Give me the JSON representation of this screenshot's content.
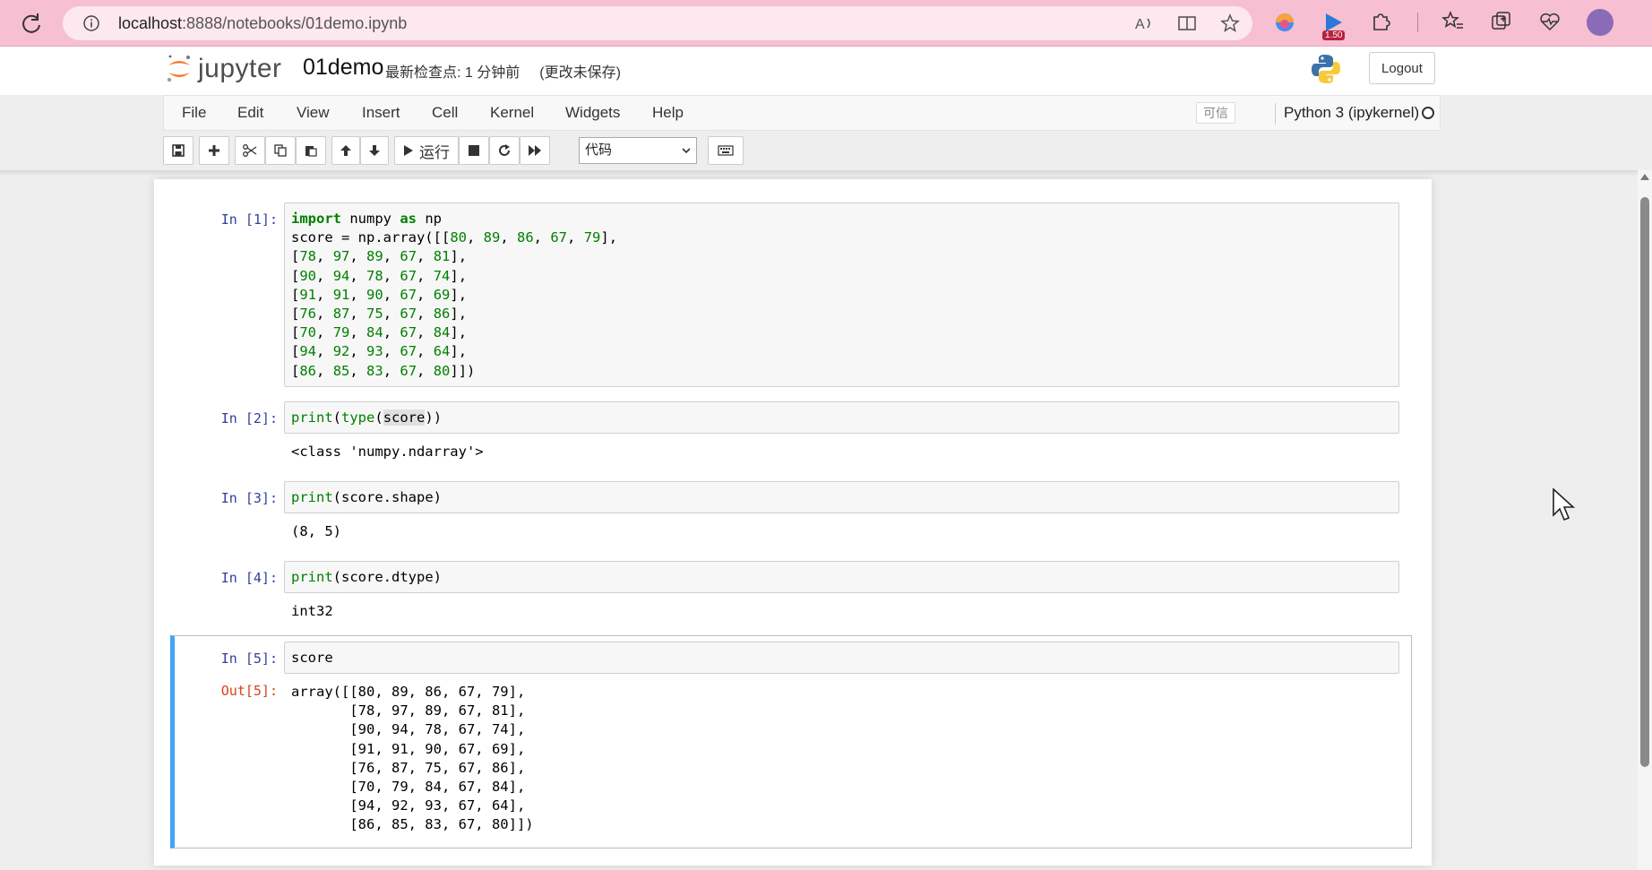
{
  "browser": {
    "url_host": "localhost",
    "url_rest": ":8888/notebooks/01demo.ipynb",
    "extension_badge": "1.50"
  },
  "header": {
    "logo_text": "jupyter",
    "notebook_name": "01demo",
    "checkpoint": "最新检查点: 1 分钟前",
    "unsaved": "(更改未保存)",
    "logout_label": "Logout"
  },
  "menubar": {
    "items": [
      "File",
      "Edit",
      "View",
      "Insert",
      "Cell",
      "Kernel",
      "Widgets",
      "Help"
    ],
    "trusted_label": "可信",
    "kernel_name": "Python 3 (ipykernel)"
  },
  "toolbar": {
    "run_label": "运行",
    "cell_type": "代码"
  },
  "cells": [
    {
      "prompt": "In  [1]:",
      "code_lines": [
        "import numpy as np",
        "score = np.array([[80, 89, 86, 67, 79],",
        "[78, 97, 89, 67, 81],",
        "[90, 94, 78, 67, 74],",
        "[91, 91, 90, 67, 69],",
        "[76, 87, 75, 67, 86],",
        "[70, 79, 84, 67, 84],",
        "[94, 92, 93, 67, 64],",
        "[86, 85, 83, 67, 80]])"
      ],
      "output": null
    },
    {
      "prompt": "In  [2]:",
      "code_lines": [
        "print(type(score))"
      ],
      "output": "<class 'numpy.ndarray'>"
    },
    {
      "prompt": "In  [3]:",
      "code_lines": [
        "print(score.shape)"
      ],
      "output": "(8, 5)"
    },
    {
      "prompt": "In  [4]:",
      "code_lines": [
        "print(score.dtype)"
      ],
      "output": "int32"
    },
    {
      "prompt": "In  [5]:",
      "code_lines": [
        "score"
      ],
      "out_prompt": "Out[5]:",
      "output": "array([[80, 89, 86, 67, 79],\n       [78, 97, 89, 67, 81],\n       [90, 94, 78, 67, 74],\n       [91, 91, 90, 67, 69],\n       [76, 87, 75, 67, 86],\n       [70, 79, 84, 67, 84],\n       [94, 92, 93, 67, 64],\n       [86, 85, 83, 67, 80]])"
    }
  ],
  "colors": {
    "browser_bar": "#f6bfd2",
    "selected_cell_border": "#42a5f5",
    "in_prompt": "#303f9f",
    "out_prompt": "#d84315",
    "keyword": "#008000"
  }
}
